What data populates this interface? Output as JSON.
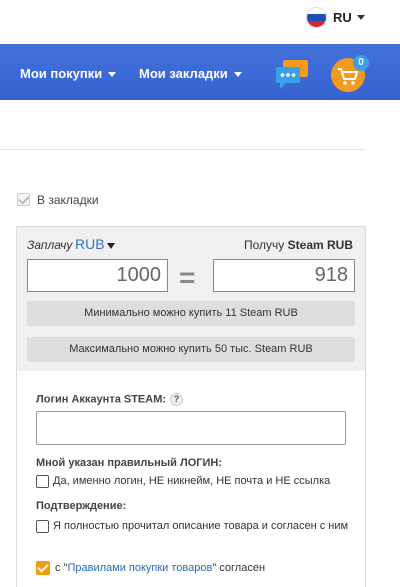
{
  "header": {
    "language": "RU",
    "flag_icon": "russia-flag-icon"
  },
  "nav": {
    "my_purchases": "Мои покупки",
    "my_bookmarks": "Мои закладки",
    "chat_icon": "chat-bubbles-icon",
    "cart_icon": "shopping-cart-icon",
    "cart_count": "0"
  },
  "bookmark": {
    "label": "В закладки"
  },
  "calc": {
    "pay_label": "Заплачу",
    "pay_currency": "RUB",
    "receive_label": "Получу",
    "receive_currency": "Steam RUB",
    "pay_value": "1000",
    "receive_value": "918",
    "min_text": "Минимально можно купить 11 Steam RUB",
    "max_text": "Максимально можно купить 50 тыс. Steam RUB"
  },
  "form": {
    "login_label": "Логин Аккаунта STEAM:",
    "help_icon": "?",
    "login_value": "",
    "correct_login_title": "Мной указан правильный ЛОГИН:",
    "correct_login_option": "Да, именно логин, НЕ никнейм, НЕ почта и НЕ ссылка",
    "confirm_title": "Подтверждение:",
    "confirm_option": "Я полностью прочитал описание товара и согласен с ним",
    "rules_prefix": "с \"",
    "rules_link": "Правилами покупки товаров",
    "rules_suffix": "\" согласен"
  },
  "colors": {
    "nav_bg": "#3d6ad7",
    "link": "#2a6ab8",
    "accent_orange": "#f39c12",
    "badge_blue": "#3aa0e8"
  }
}
